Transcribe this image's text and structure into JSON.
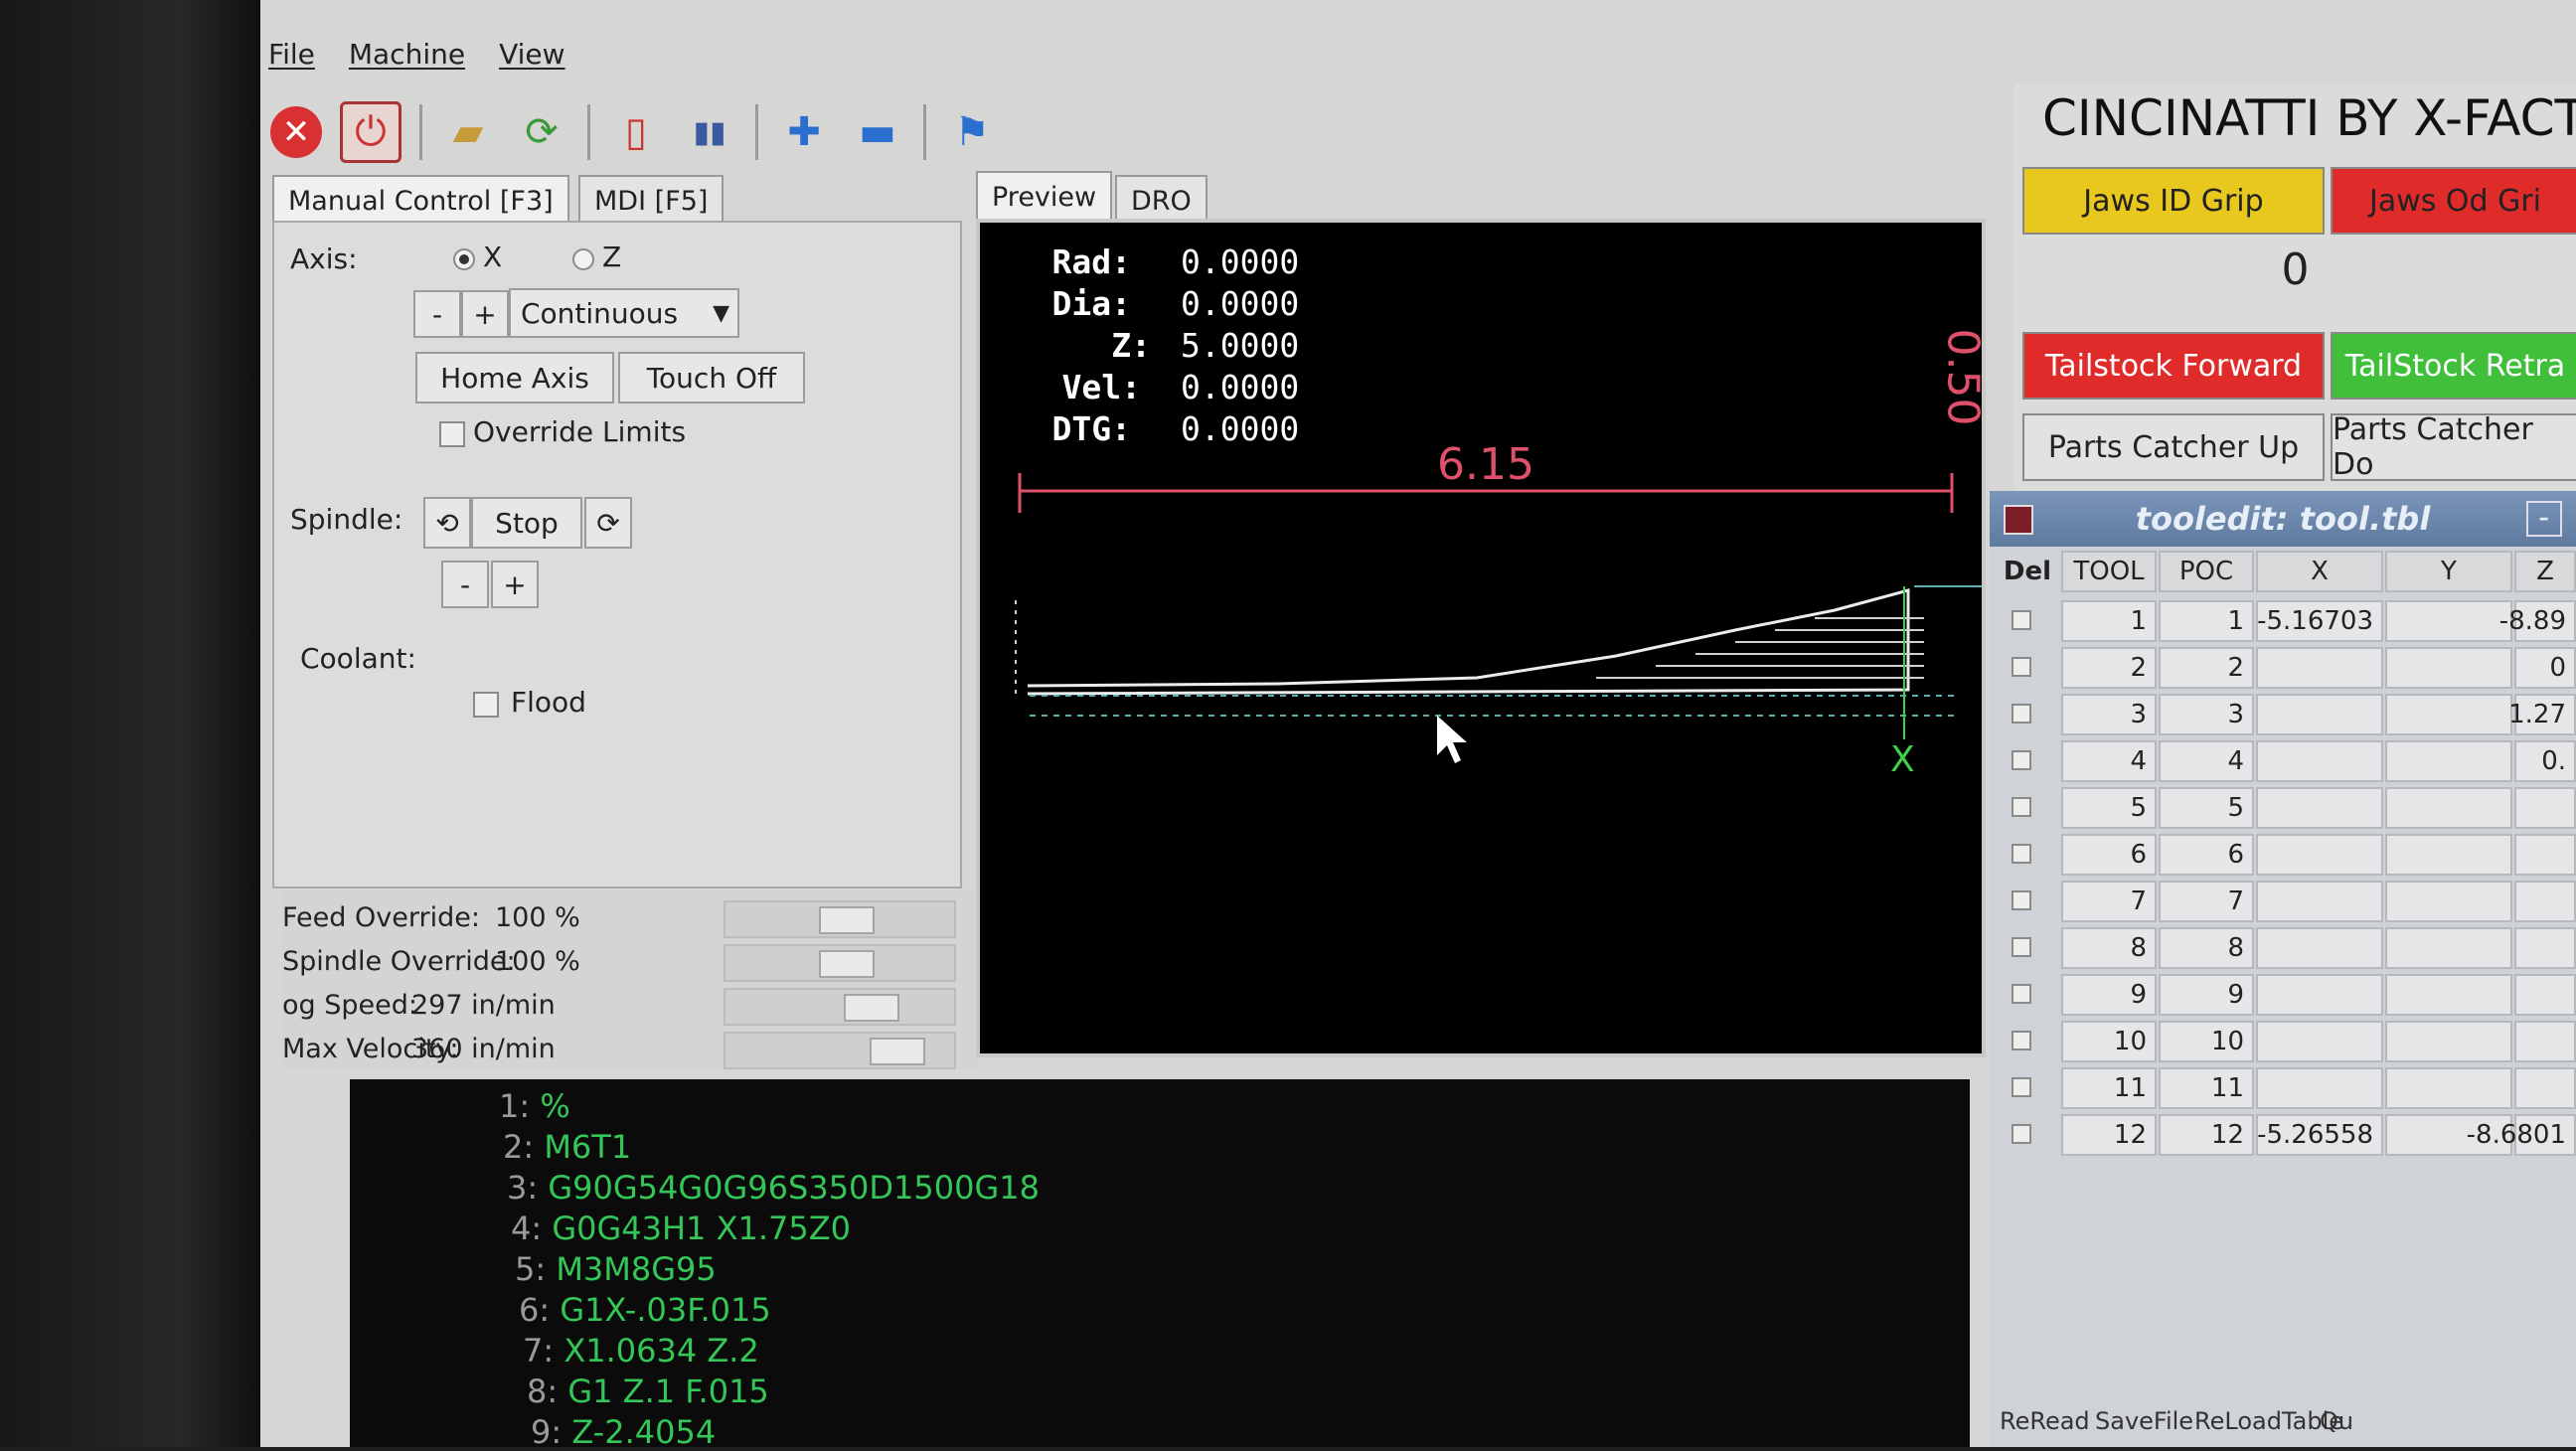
{
  "menu": [
    "File",
    "Machine",
    "View"
  ],
  "toolbar_icons": [
    "estop-icon",
    "power-icon",
    "open-file-icon",
    "reload-icon",
    "run-icon",
    "m1-icon",
    "zoom-in-icon",
    "zoom-out-icon",
    "clear-icon"
  ],
  "tabs": {
    "manual": "Manual Control [F3]",
    "mdi": "MDI [F5]",
    "preview": "Preview",
    "dro": "DRO"
  },
  "manual": {
    "axis_label": "Axis:",
    "axis_x": "X",
    "axis_z": "Z",
    "minus": "-",
    "plus": "+",
    "jog_mode": "Continuous",
    "home_axis": "Home Axis",
    "touch_off": "Touch Off",
    "override_limits": "Override Limits",
    "spindle_label": "Spindle:",
    "spindle_stop": "Stop",
    "coolant_label": "Coolant:",
    "flood": "Flood"
  },
  "overrides": [
    {
      "label": "Feed Override:",
      "value": "100 %",
      "position": 0.55
    },
    {
      "label": "Spindle Override:",
      "value": "100 %",
      "position": 0.55
    },
    {
      "label": "og Speed:",
      "value": "297 in/min",
      "position": 0.7
    },
    {
      "label": "Max Velocity:",
      "value": "360 in/min",
      "position": 0.85
    }
  ],
  "dro": {
    "labels": [
      "Rad:",
      "Dia:",
      "Z:",
      "Vel:",
      "DTG:"
    ],
    "values": [
      "0.0000",
      "0.0000",
      "5.0000",
      "0.0000",
      "0.0000"
    ],
    "dim_horizontal": "6.15",
    "dim_vertical": "0.50",
    "axis_marker": "X"
  },
  "gcode": [
    {
      "n": "1:",
      "code": "%"
    },
    {
      "n": "2:",
      "code": "M6T1"
    },
    {
      "n": "3:",
      "code": "G90G54G0G96S350D1500G18"
    },
    {
      "n": "4:",
      "code": "G0G43H1 X1.75Z0"
    },
    {
      "n": "5:",
      "code": "M3M8G95"
    },
    {
      "n": "6:",
      "code": "G1X-.03F.015"
    },
    {
      "n": "7:",
      "code": "X1.0634 Z.2"
    },
    {
      "n": "8:",
      "code": "G1 Z.1 F.015"
    },
    {
      "n": "9:",
      "code": "Z-2.4054"
    }
  ],
  "right": {
    "title": "CINCINATTI BY X-FACT",
    "jaws_id": "Jaws ID Grip",
    "jaws_od": "Jaws Od Gri",
    "counter": "0",
    "tailstock_fwd": "Tailstock Forward",
    "tailstock_ret": "TailStock Retra",
    "parts_up": "Parts Catcher Up",
    "parts_down": "Parts Catcher Do",
    "colors": {
      "yellow": "#e8c81e",
      "red": "#e02b2b",
      "green": "#3fbf3a"
    }
  },
  "tooledit": {
    "title": "tooledit: tool.tbl",
    "headers": [
      "Del",
      "TOOL",
      "POC",
      "X",
      "Y",
      "Z"
    ],
    "rows": [
      {
        "tool": "1",
        "poc": "1",
        "x": "-5.16703",
        "y": "",
        "z": "-8.89"
      },
      {
        "tool": "2",
        "poc": "2",
        "x": "",
        "y": "",
        "z": "0"
      },
      {
        "tool": "3",
        "poc": "3",
        "x": "",
        "y": "",
        "z": "1.27"
      },
      {
        "tool": "4",
        "poc": "4",
        "x": "",
        "y": "",
        "z": "0."
      },
      {
        "tool": "5",
        "poc": "5",
        "x": "",
        "y": "",
        "z": ""
      },
      {
        "tool": "6",
        "poc": "6",
        "x": "",
        "y": "",
        "z": ""
      },
      {
        "tool": "7",
        "poc": "7",
        "x": "",
        "y": "",
        "z": ""
      },
      {
        "tool": "8",
        "poc": "8",
        "x": "",
        "y": "",
        "z": ""
      },
      {
        "tool": "9",
        "poc": "9",
        "x": "",
        "y": "",
        "z": ""
      },
      {
        "tool": "10",
        "poc": "10",
        "x": "",
        "y": "",
        "z": ""
      },
      {
        "tool": "11",
        "poc": "11",
        "x": "",
        "y": "",
        "z": ""
      },
      {
        "tool": "12",
        "poc": "12",
        "x": "-5.26558",
        "y": "",
        "z": "-8.6801"
      }
    ],
    "footer": [
      "ReRead",
      "SaveFile",
      "ReLoadTable",
      "Qu"
    ]
  }
}
